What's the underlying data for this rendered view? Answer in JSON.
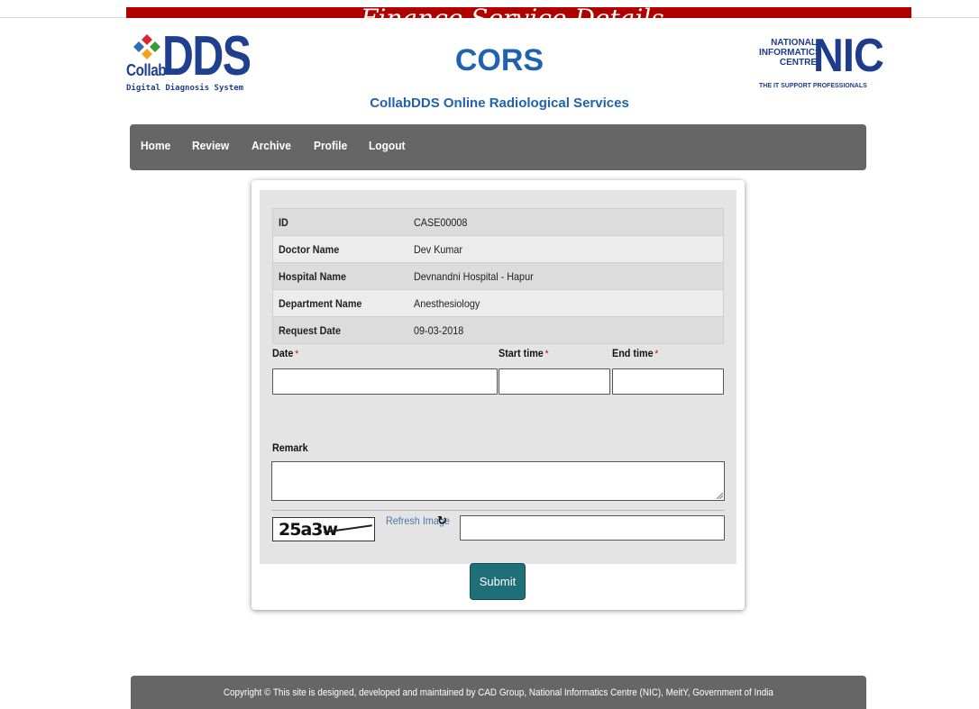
{
  "banner": {
    "text": "Finance Service Details"
  },
  "header": {
    "left_logo": {
      "brand": "DDS",
      "sub_brand": "Collab",
      "tagline": "Digital Diagnosis System"
    },
    "title": "CORS",
    "subtitle": "CollabDDS Online Radiological Services",
    "right_logo": {
      "line1": "NATIONAL",
      "line2": "INFORMATICS",
      "line3": "CENTRE",
      "mark": "NIC",
      "tagline": "THE IT SUPPORT PROFESSIONALS"
    }
  },
  "nav": {
    "items": [
      "Home",
      "Review",
      "Archive",
      "Profile",
      "Logout"
    ]
  },
  "details": {
    "rows": [
      {
        "label": "ID",
        "value": "CASE00008"
      },
      {
        "label": "Doctor Name",
        "value": "Dev Kumar"
      },
      {
        "label": "Hospital Name",
        "value": "Devnandni Hospital - Hapur"
      },
      {
        "label": "Department Name",
        "value": "Anesthesiology"
      },
      {
        "label": "Request Date",
        "value": "09-03-2018"
      }
    ]
  },
  "form": {
    "date_label": "Date",
    "start_label": "Start time",
    "end_label": "End time",
    "required_mark": "*",
    "date_value": "",
    "start_value": "",
    "end_value": "",
    "remark_label": "Remark",
    "remark_value": "",
    "captcha_code": "25a3w",
    "refresh_label": "Refresh Image",
    "captcha_input_value": "",
    "submit_label": "Submit"
  },
  "colors": {
    "nav_bg": "#666666",
    "submit_bg": "#1f6f78",
    "title": "#1f62b0",
    "required": "#d00000"
  },
  "footer": {
    "text": "Copyright © This site is designed, developed and maintained by CAD Group, National Informatics Centre (NIC), MeitY, Government of India"
  }
}
